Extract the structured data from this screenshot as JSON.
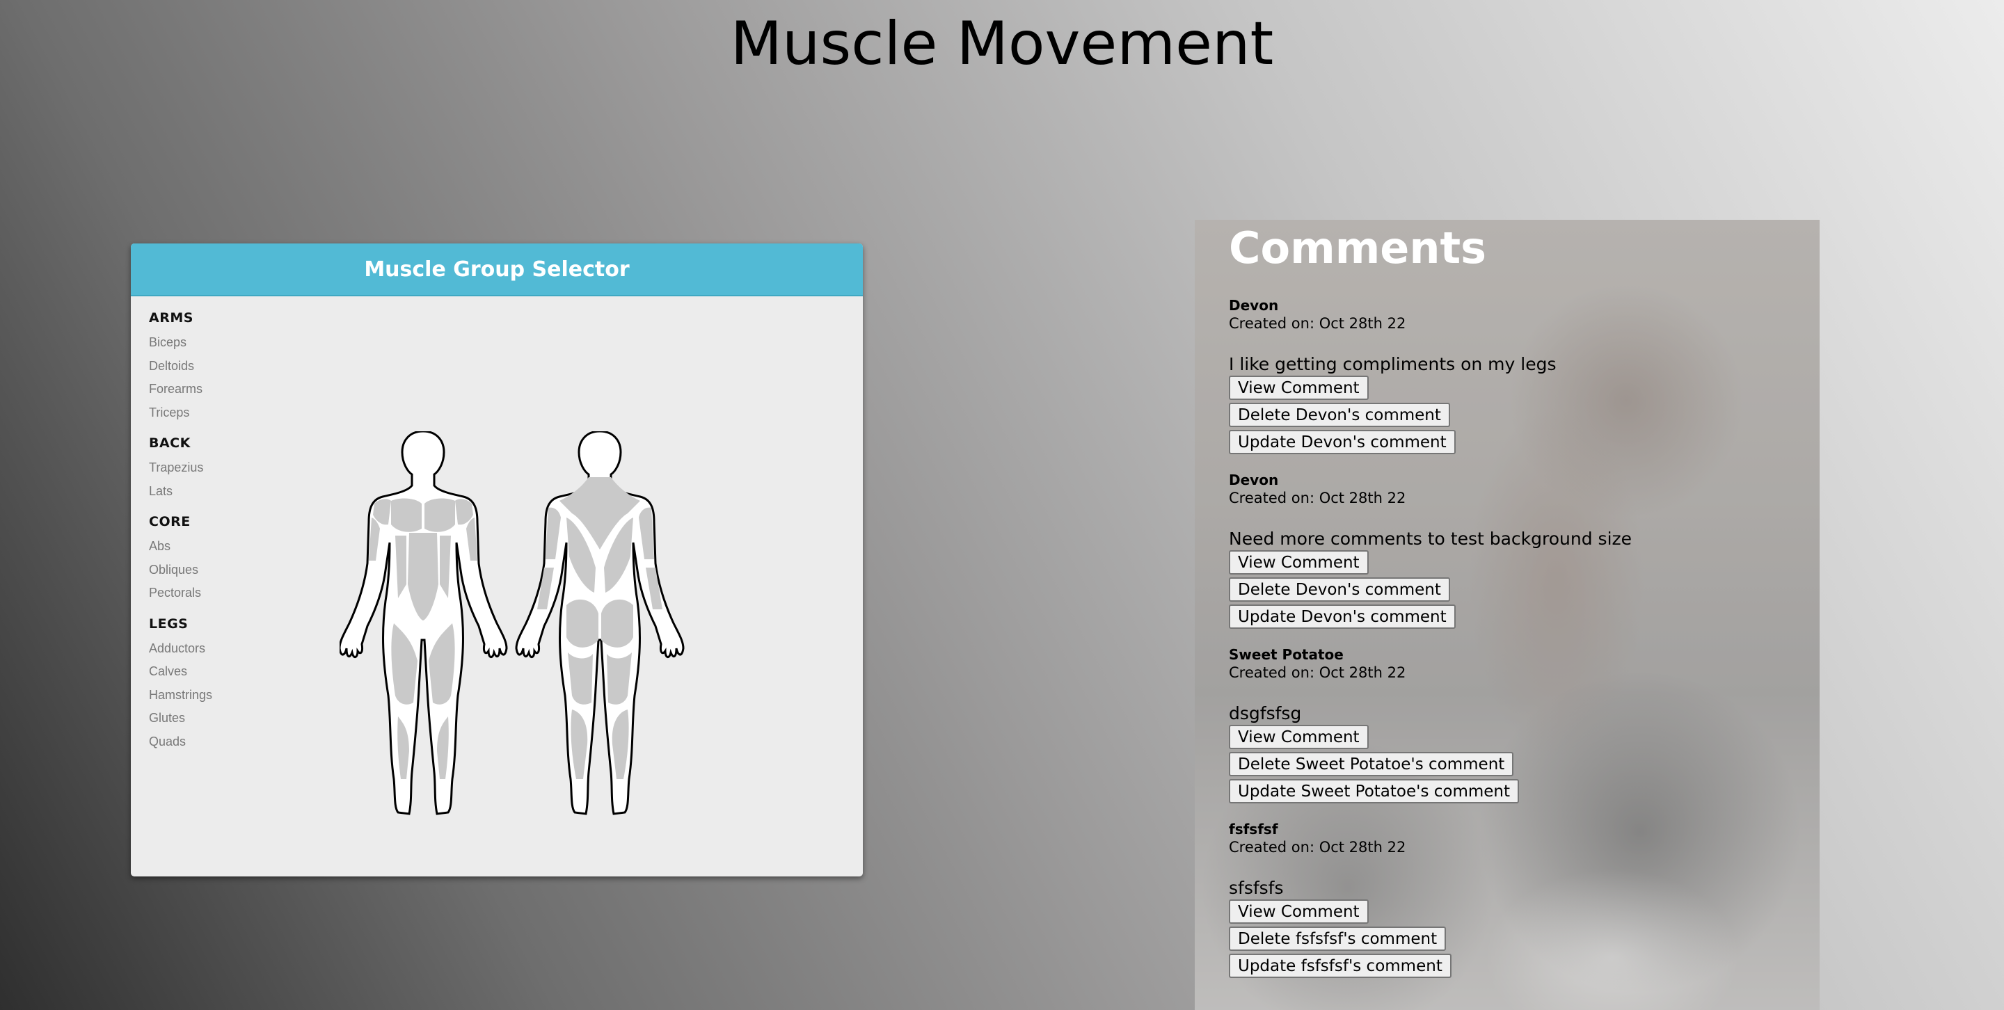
{
  "page": {
    "title": "Muscle Movement"
  },
  "selector": {
    "title": "Muscle Group Selector",
    "groups": [
      {
        "name": "ARMS",
        "items": [
          "Biceps",
          "Deltoids",
          "Forearms",
          "Triceps"
        ]
      },
      {
        "name": "BACK",
        "items": [
          "Trapezius",
          "Lats"
        ]
      },
      {
        "name": "CORE",
        "items": [
          "Abs",
          "Obliques",
          "Pectorals"
        ]
      },
      {
        "name": "LEGS",
        "items": [
          "Adductors",
          "Calves",
          "Hamstrings",
          "Glutes",
          "Quads"
        ]
      }
    ]
  },
  "comments": {
    "heading": "Comments",
    "items": [
      {
        "author": "Devon",
        "created": "Created on: Oct 28th 22",
        "text": "I like getting compliments on my legs",
        "view_label": "View Comment",
        "delete_label": "Delete Devon's comment",
        "update_label": "Update Devon's comment"
      },
      {
        "author": "Devon",
        "created": "Created on: Oct 28th 22",
        "text": "Need more comments to test background size",
        "view_label": "View Comment",
        "delete_label": "Delete Devon's comment",
        "update_label": "Update Devon's comment"
      },
      {
        "author": "Sweet Potatoe",
        "created": "Created on: Oct 28th 22",
        "text": "dsgfsfsg",
        "view_label": "View Comment",
        "delete_label": "Delete Sweet Potatoe's comment",
        "update_label": "Update Sweet Potatoe's comment"
      },
      {
        "author": "fsfsfsf",
        "created": "Created on: Oct 28th 22",
        "text": "sfsfsfs",
        "view_label": "View Comment",
        "delete_label": "Delete fsfsfsf's comment",
        "update_label": "Update fsfsfsf's comment"
      }
    ]
  },
  "colors": {
    "header_accent": "#52bad5",
    "card_background": "#ececec"
  }
}
